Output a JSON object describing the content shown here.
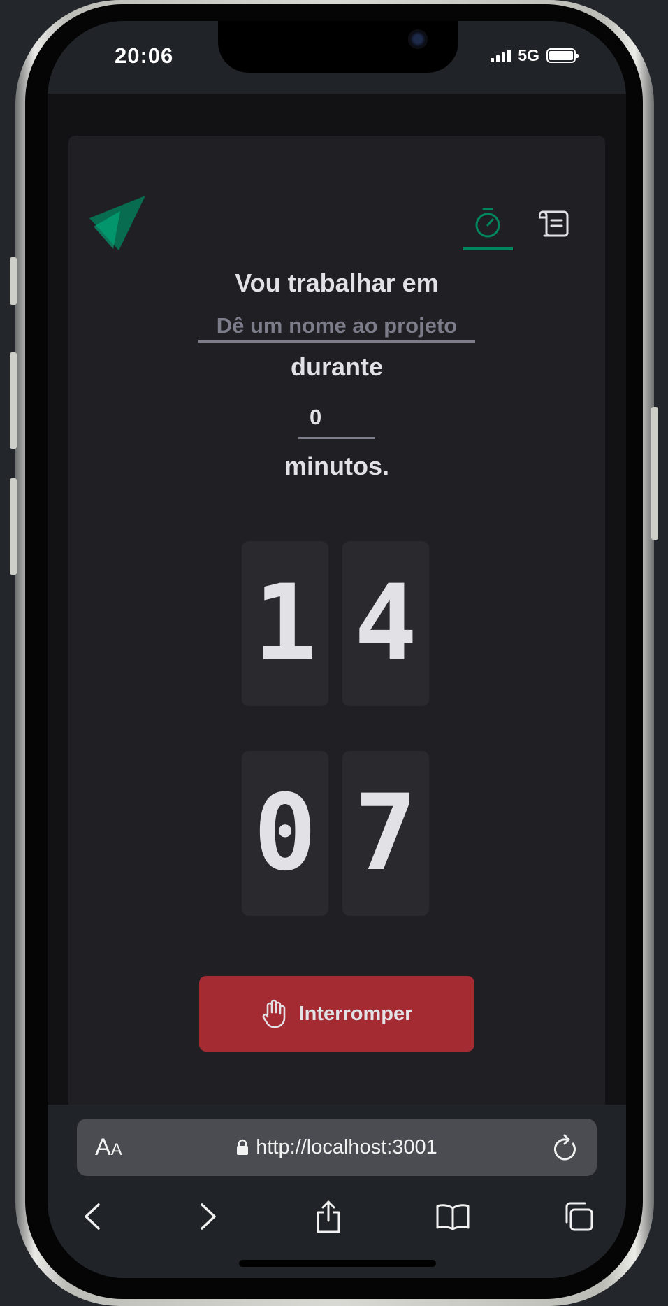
{
  "status_bar": {
    "time": "20:06",
    "network": "5G"
  },
  "app": {
    "nav": [
      {
        "icon": "timer-icon",
        "active": true
      },
      {
        "icon": "scroll-icon",
        "active": false
      }
    ],
    "form": {
      "label_working_on": "Vou trabalhar em",
      "project_placeholder": "Dê um nome ao projeto",
      "label_during": "durante",
      "minutes_value": "0",
      "label_minutes": "minutos."
    },
    "countdown": {
      "minutes": [
        "1",
        "4"
      ],
      "seconds": [
        "0",
        "7"
      ]
    },
    "stop_button": {
      "label": "Interromper",
      "icon": "hand-palm-icon"
    },
    "colors": {
      "accent": "#00875f",
      "danger": "#a52b33",
      "card": "#202024"
    }
  },
  "browser": {
    "text_size_label": "AA",
    "url": "http://localhost:3001"
  }
}
